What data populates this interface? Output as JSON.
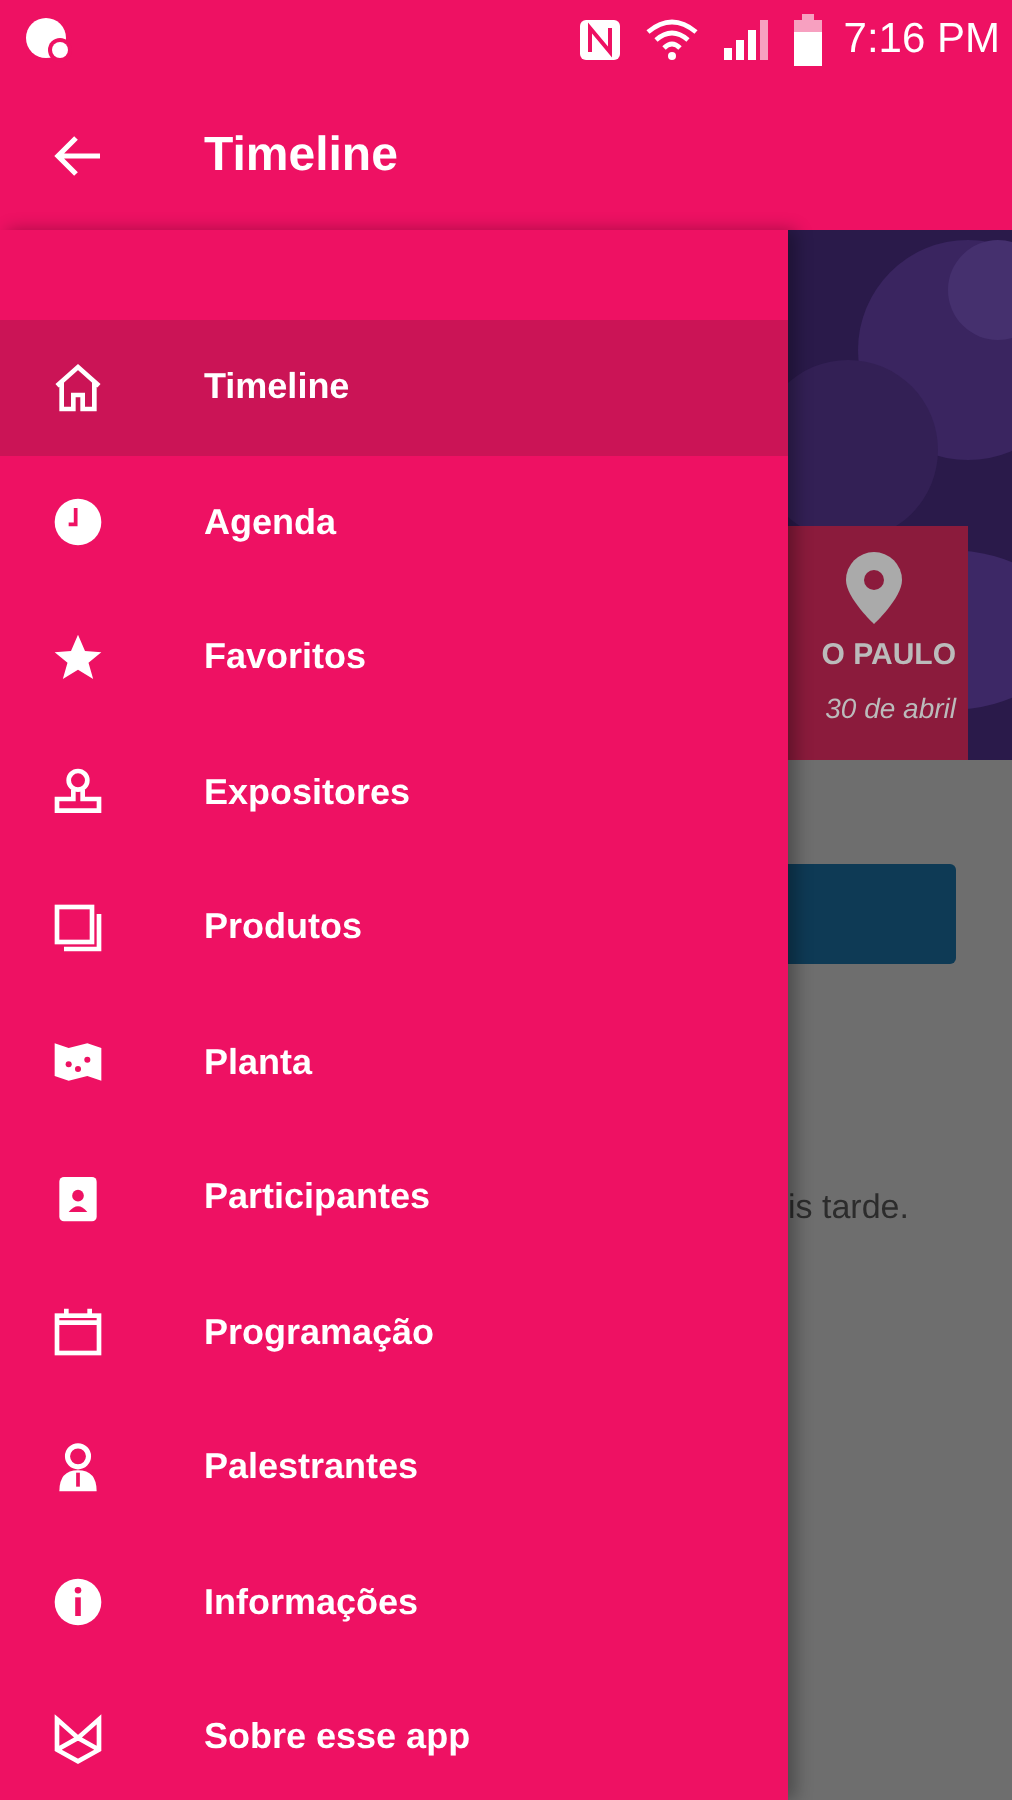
{
  "status_bar": {
    "time": "7:16 PM"
  },
  "toolbar": {
    "title": "Timeline"
  },
  "drawer": {
    "items": [
      {
        "label": "Timeline",
        "selected": true
      },
      {
        "label": "Agenda",
        "selected": false
      },
      {
        "label": "Favoritos",
        "selected": false
      },
      {
        "label": "Expositores",
        "selected": false
      },
      {
        "label": "Produtos",
        "selected": false
      },
      {
        "label": "Planta",
        "selected": false
      },
      {
        "label": "Participantes",
        "selected": false
      },
      {
        "label": "Programação",
        "selected": false
      },
      {
        "label": "Palestrantes",
        "selected": false
      },
      {
        "label": "Informações",
        "selected": false
      },
      {
        "label": "Sobre esse app",
        "selected": false
      }
    ]
  },
  "background": {
    "event_card": {
      "city": "O PAULO",
      "date": "30 de abril"
    },
    "message": "is tarde."
  }
}
